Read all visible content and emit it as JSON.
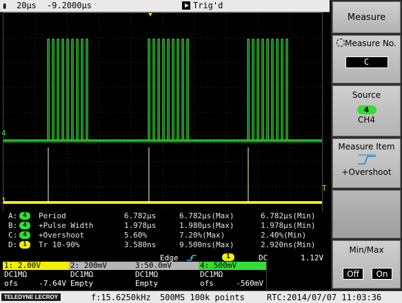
{
  "top_bar": {
    "timebase": "20µs",
    "delay": "-9.2000µs",
    "trigger_status": "Trig'd"
  },
  "colors": {
    "ch1": "#f0f000",
    "ch2": "#e0e0e0",
    "ch3": "#e0e0e0",
    "ch4": "#33dd33",
    "menu_key": "#c4c4c4"
  },
  "scope": {
    "ch4_marker": "4",
    "ch1_marker": "1",
    "trigger_marker": "T"
  },
  "measurements": [
    {
      "source": "A:",
      "channel": "4",
      "name": "Period",
      "value": "6.782µs",
      "max": "6.782µs(Max)",
      "min": "6.782µs(Min)"
    },
    {
      "source": "B:",
      "channel": "4",
      "name": "+Pulse Width",
      "value": "1.978µs",
      "max": "1.980µs(Max)",
      "min": "1.978µs(Min)"
    },
    {
      "source": "C:",
      "channel": "4",
      "name": "+Overshoot",
      "value": "5.60%",
      "max": "7.20%(Max)",
      "min": "2.40%(Min)"
    },
    {
      "source": "D:",
      "channel": "1",
      "name": "Tr 10-90%",
      "value": "3.580ns",
      "max": "9.500ns(Max)",
      "min": "2.920ns(Min)"
    }
  ],
  "trigger_info": {
    "type": "Edge",
    "source": "1",
    "coupling": "DC",
    "level": "1.12V"
  },
  "channels": [
    {
      "header": "1: 2.00V",
      "coupling": "DC1MΩ",
      "offset_label": "ofs",
      "offset": "-7.64V"
    },
    {
      "header": "2: 200mV",
      "coupling": "DC1MΩ",
      "offset_label": "Empty",
      "offset": ""
    },
    {
      "header": "3:50.0mV",
      "coupling": "DC1MΩ",
      "offset_label": "Empty",
      "offset": ""
    },
    {
      "header": "4: 500mV",
      "coupling": "DC1MΩ",
      "offset_label": "ofs",
      "offset": "-560mV"
    }
  ],
  "bottom_bar": {
    "brand": "TELEDYNE LECROY",
    "frequency": "f:15.6250kHz",
    "acquisition": "500MS 100k points",
    "clock": "RTC:2014/07/07 11:03:36"
  },
  "menu": {
    "title": "Measure",
    "measure_no_label": "Measure No.",
    "measure_no_value": "C",
    "source_label": "Source",
    "source_channel": "4",
    "source_value": "CH4",
    "item_label": "Measure Item",
    "item_value": "+Overshoot",
    "minmax_label": "Min/Max",
    "off_label": "Off",
    "on_label": "On"
  }
}
